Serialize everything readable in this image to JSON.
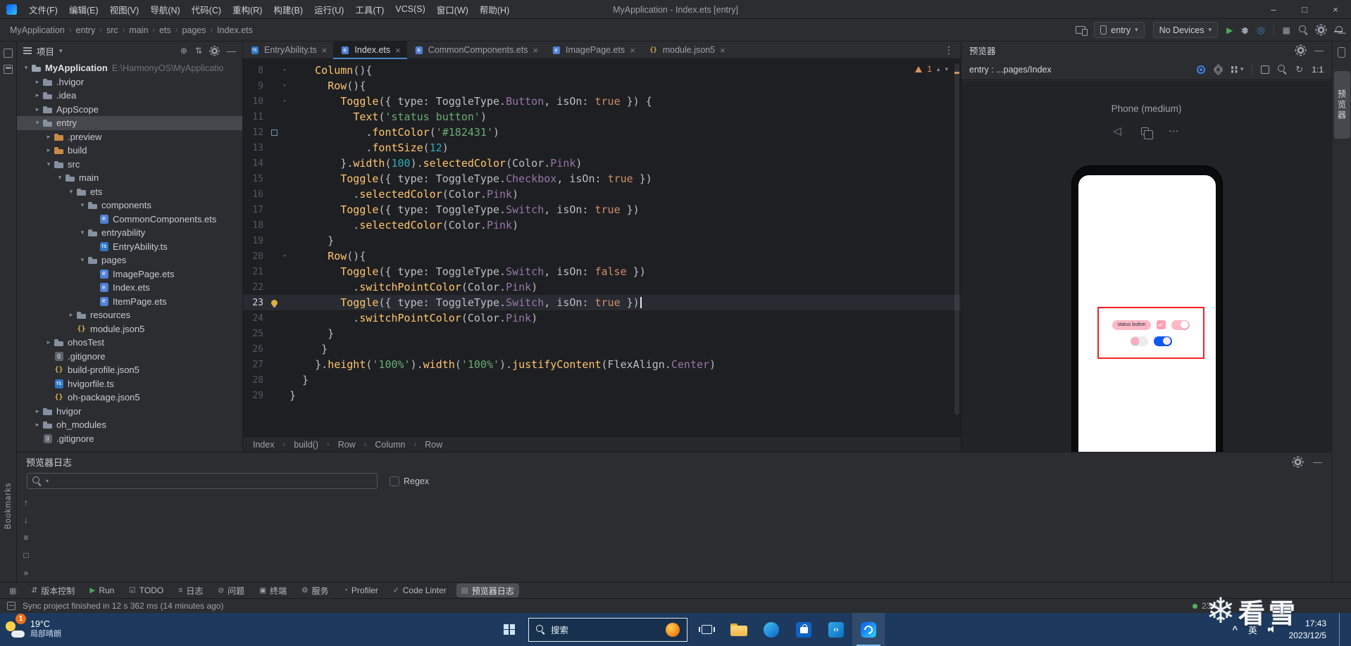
{
  "title_bar": {
    "app_title": "MyApplication - Index.ets [entry]",
    "menus": [
      "文件(F)",
      "编辑(E)",
      "视图(V)",
      "导航(N)",
      "代码(C)",
      "重构(R)",
      "构建(B)",
      "运行(U)",
      "工具(T)",
      "VCS(S)",
      "窗口(W)",
      "帮助(H)"
    ],
    "window_controls": {
      "minimize": "–",
      "maximize": "□",
      "close": "×"
    }
  },
  "toolbar": {
    "breadcrumbs": [
      "MyApplication",
      "entry",
      "src",
      "main",
      "ets",
      "pages",
      "Index.ets"
    ],
    "module_selector": "entry",
    "device_selector": "No Devices"
  },
  "left_stripe": {
    "bookmarks_label": "Bookmarks"
  },
  "project_panel": {
    "title": "项目",
    "tree": [
      {
        "depth": 0,
        "chev": "v",
        "icon": "project",
        "label": "MyApplication",
        "suffix": "E:\\HarmonyOS\\MyApplicatio",
        "bold": true
      },
      {
        "depth": 1,
        "chev": ">",
        "icon": "folder",
        "label": ".hvigor"
      },
      {
        "depth": 1,
        "chev": ">",
        "icon": "folder",
        "label": ".idea"
      },
      {
        "depth": 1,
        "chev": ">",
        "icon": "folder",
        "label": "AppScope"
      },
      {
        "depth": 1,
        "chev": "v",
        "icon": "folder",
        "label": "entry",
        "selected": true
      },
      {
        "depth": 2,
        "chev": ">",
        "icon": "folder-o",
        "label": ".preview"
      },
      {
        "depth": 2,
        "chev": ">",
        "icon": "folder-o",
        "label": "build"
      },
      {
        "depth": 2,
        "chev": "v",
        "icon": "folder",
        "label": "src"
      },
      {
        "depth": 3,
        "chev": "v",
        "icon": "folder",
        "label": "main"
      },
      {
        "depth": 4,
        "chev": "v",
        "icon": "folder",
        "label": "ets"
      },
      {
        "depth": 5,
        "chev": "v",
        "icon": "folder",
        "label": "components"
      },
      {
        "depth": 6,
        "chev": "",
        "icon": "ets",
        "label": "CommonComponents.ets"
      },
      {
        "depth": 5,
        "chev": "v",
        "icon": "folder",
        "label": "entryability"
      },
      {
        "depth": 6,
        "chev": "",
        "icon": "ts",
        "label": "EntryAbility.ts"
      },
      {
        "depth": 5,
        "chev": "v",
        "icon": "folder",
        "label": "pages"
      },
      {
        "depth": 6,
        "chev": "",
        "icon": "ets",
        "label": "ImagePage.ets"
      },
      {
        "depth": 6,
        "chev": "",
        "icon": "ets",
        "label": "Index.ets"
      },
      {
        "depth": 6,
        "chev": "",
        "icon": "ets",
        "label": "ItemPage.ets"
      },
      {
        "depth": 4,
        "chev": ">",
        "icon": "folder",
        "label": "resources"
      },
      {
        "depth": 4,
        "chev": "",
        "icon": "json",
        "label": "module.json5"
      },
      {
        "depth": 2,
        "chev": ">",
        "icon": "folder",
        "label": "ohosTest"
      },
      {
        "depth": 2,
        "chev": "",
        "icon": "git",
        "label": ".gitignore"
      },
      {
        "depth": 2,
        "chev": "",
        "icon": "json",
        "label": "build-profile.json5"
      },
      {
        "depth": 2,
        "chev": "",
        "icon": "ts",
        "label": "hvigorfile.ts"
      },
      {
        "depth": 2,
        "chev": "",
        "icon": "json",
        "label": "oh-package.json5"
      },
      {
        "depth": 1,
        "chev": ">",
        "icon": "folder",
        "label": "hvigor"
      },
      {
        "depth": 1,
        "chev": ">",
        "icon": "folder",
        "label": "oh_modules"
      },
      {
        "depth": 1,
        "chev": "",
        "icon": "git",
        "label": ".gitignore"
      }
    ]
  },
  "editor": {
    "tabs": [
      {
        "label": "EntryAbility.ts",
        "icon": "ts"
      },
      {
        "label": "Index.ets",
        "icon": "ets",
        "active": true
      },
      {
        "label": "CommonComponents.ets",
        "icon": "ets"
      },
      {
        "label": "ImagePage.ets",
        "icon": "ets"
      },
      {
        "label": "module.json5",
        "icon": "json"
      }
    ],
    "warning_count": "1",
    "current_line": 23,
    "breadcrumb": [
      "Index",
      "build()",
      "Row",
      "Column",
      "Row"
    ],
    "lines": [
      {
        "n": 8,
        "fold": true,
        "t": [
          [
            "p",
            "    "
          ],
          [
            "c",
            "Column"
          ],
          [
            "p",
            "(){"
          ]
        ]
      },
      {
        "n": 9,
        "fold": true,
        "t": [
          [
            "p",
            "      "
          ],
          [
            "c",
            "Row"
          ],
          [
            "p",
            "(){"
          ]
        ]
      },
      {
        "n": 10,
        "fold": true,
        "t": [
          [
            "p",
            "        "
          ],
          [
            "c",
            "Toggle"
          ],
          [
            "p",
            "({ type: ToggleType."
          ],
          [
            "e",
            "Button"
          ],
          [
            "p",
            ", isOn: "
          ],
          [
            "k",
            "true"
          ],
          [
            "p",
            " }) {"
          ]
        ]
      },
      {
        "n": 11,
        "t": [
          [
            "p",
            "          "
          ],
          [
            "c",
            "Text"
          ],
          [
            "p",
            "("
          ],
          [
            "s",
            "'status button'"
          ],
          [
            "p",
            ")"
          ]
        ]
      },
      {
        "n": 12,
        "chip": "#182431",
        "t": [
          [
            "p",
            "            ."
          ],
          [
            "c",
            "fontColor"
          ],
          [
            "p",
            "("
          ],
          [
            "s",
            "'#182431'"
          ],
          [
            "p",
            ")"
          ]
        ]
      },
      {
        "n": 13,
        "t": [
          [
            "p",
            "            ."
          ],
          [
            "c",
            "fontSize"
          ],
          [
            "p",
            "("
          ],
          [
            "n",
            "12"
          ],
          [
            "p",
            ")"
          ]
        ]
      },
      {
        "n": 14,
        "t": [
          [
            "p",
            "        }."
          ],
          [
            "c",
            "width"
          ],
          [
            "p",
            "("
          ],
          [
            "n",
            "100"
          ],
          [
            "p",
            ")."
          ],
          [
            "c",
            "selectedColor"
          ],
          [
            "p",
            "(Color."
          ],
          [
            "e",
            "Pink"
          ],
          [
            "p",
            ")"
          ]
        ]
      },
      {
        "n": 15,
        "t": [
          [
            "p",
            "        "
          ],
          [
            "c",
            "Toggle"
          ],
          [
            "p",
            "({ type: ToggleType."
          ],
          [
            "e",
            "Checkbox"
          ],
          [
            "p",
            ", isOn: "
          ],
          [
            "k",
            "true"
          ],
          [
            "p",
            " })"
          ]
        ]
      },
      {
        "n": 16,
        "t": [
          [
            "p",
            "          ."
          ],
          [
            "c",
            "selectedColor"
          ],
          [
            "p",
            "(Color."
          ],
          [
            "e",
            "Pink"
          ],
          [
            "p",
            ")"
          ]
        ]
      },
      {
        "n": 17,
        "t": [
          [
            "p",
            "        "
          ],
          [
            "c",
            "Toggle"
          ],
          [
            "p",
            "({ type: ToggleType."
          ],
          [
            "e",
            "Switch"
          ],
          [
            "p",
            ", isOn: "
          ],
          [
            "k",
            "true"
          ],
          [
            "p",
            " })"
          ]
        ]
      },
      {
        "n": 18,
        "t": [
          [
            "p",
            "          ."
          ],
          [
            "c",
            "selectedColor"
          ],
          [
            "p",
            "(Color."
          ],
          [
            "e",
            "Pink"
          ],
          [
            "p",
            ")"
          ]
        ]
      },
      {
        "n": 19,
        "t": [
          [
            "p",
            "      }"
          ]
        ]
      },
      {
        "n": 20,
        "fold": true,
        "t": [
          [
            "p",
            "      "
          ],
          [
            "c",
            "Row"
          ],
          [
            "p",
            "(){"
          ]
        ]
      },
      {
        "n": 21,
        "t": [
          [
            "p",
            "        "
          ],
          [
            "c",
            "Toggle"
          ],
          [
            "p",
            "({ type: ToggleType."
          ],
          [
            "e",
            "Switch"
          ],
          [
            "p",
            ", isOn: "
          ],
          [
            "k",
            "false"
          ],
          [
            "p",
            " })"
          ]
        ]
      },
      {
        "n": 22,
        "t": [
          [
            "p",
            "          ."
          ],
          [
            "c",
            "switchPointColor"
          ],
          [
            "p",
            "(Color."
          ],
          [
            "e",
            "Pink"
          ],
          [
            "p",
            ")"
          ]
        ]
      },
      {
        "n": 23,
        "bulb": true,
        "caret": true,
        "t": [
          [
            "p",
            "        "
          ],
          [
            "c",
            "Toggle"
          ],
          [
            "p",
            "({ type: ToggleType."
          ],
          [
            "e",
            "Switch"
          ],
          [
            "p",
            ", isOn: "
          ],
          [
            "k",
            "true"
          ],
          [
            "p",
            " })"
          ]
        ]
      },
      {
        "n": 24,
        "t": [
          [
            "p",
            "          ."
          ],
          [
            "c",
            "switchPointColor"
          ],
          [
            "p",
            "(Color."
          ],
          [
            "e",
            "Pink"
          ],
          [
            "p",
            ")"
          ]
        ]
      },
      {
        "n": 25,
        "t": [
          [
            "p",
            "      }"
          ]
        ]
      },
      {
        "n": 26,
        "t": [
          [
            "p",
            "     }"
          ]
        ]
      },
      {
        "n": 27,
        "t": [
          [
            "p",
            "    }."
          ],
          [
            "c",
            "height"
          ],
          [
            "p",
            "("
          ],
          [
            "s",
            "'100%'"
          ],
          [
            "p",
            ")."
          ],
          [
            "c",
            "width"
          ],
          [
            "p",
            "("
          ],
          [
            "s",
            "'100%'"
          ],
          [
            "p",
            ")."
          ],
          [
            "c",
            "justifyContent"
          ],
          [
            "p",
            "(FlexAlign."
          ],
          [
            "e",
            "Center"
          ],
          [
            "p",
            ")"
          ]
        ]
      },
      {
        "n": 28,
        "t": [
          [
            "p",
            "  }"
          ]
        ]
      },
      {
        "n": 29,
        "t": [
          [
            "p",
            "}"
          ]
        ]
      }
    ]
  },
  "previewer": {
    "title": "预览器",
    "target": "entry : ...pages/Index",
    "zoom": "1:1",
    "device_label": "Phone (medium)",
    "screen": {
      "toggle_button_label": "status button"
    }
  },
  "right_stripe": {
    "previewer_tab": "预览器"
  },
  "log_panel": {
    "title": "预览器日志",
    "regex_label": "Regex"
  },
  "bottom_bar": {
    "items": [
      {
        "icon": "vcs",
        "label": "版本控制"
      },
      {
        "icon": "run",
        "label": "Run"
      },
      {
        "icon": "todo",
        "label": "TODO"
      },
      {
        "icon": "log",
        "label": "日志"
      },
      {
        "icon": "problems",
        "label": "问题"
      },
      {
        "icon": "terminal",
        "label": "终端"
      },
      {
        "icon": "services",
        "label": "服务"
      },
      {
        "icon": "profiler",
        "label": "Profiler"
      },
      {
        "icon": "lint",
        "label": "Code Linter"
      },
      {
        "icon": "previewer-log",
        "label": "预览器日志",
        "active": true
      }
    ]
  },
  "status_bar": {
    "message": "Sync project finished in 12 s 362 ms (14 minutes ago)",
    "time": "23:58"
  },
  "taskbar": {
    "weather_temp": "19°C",
    "weather_desc": "局部晴朗",
    "notification_badge": "1",
    "search_placeholder": "搜索",
    "input_lang": "英",
    "time": "17:43",
    "date": "2023/12/5"
  },
  "watermark": {
    "text": "看雪"
  }
}
